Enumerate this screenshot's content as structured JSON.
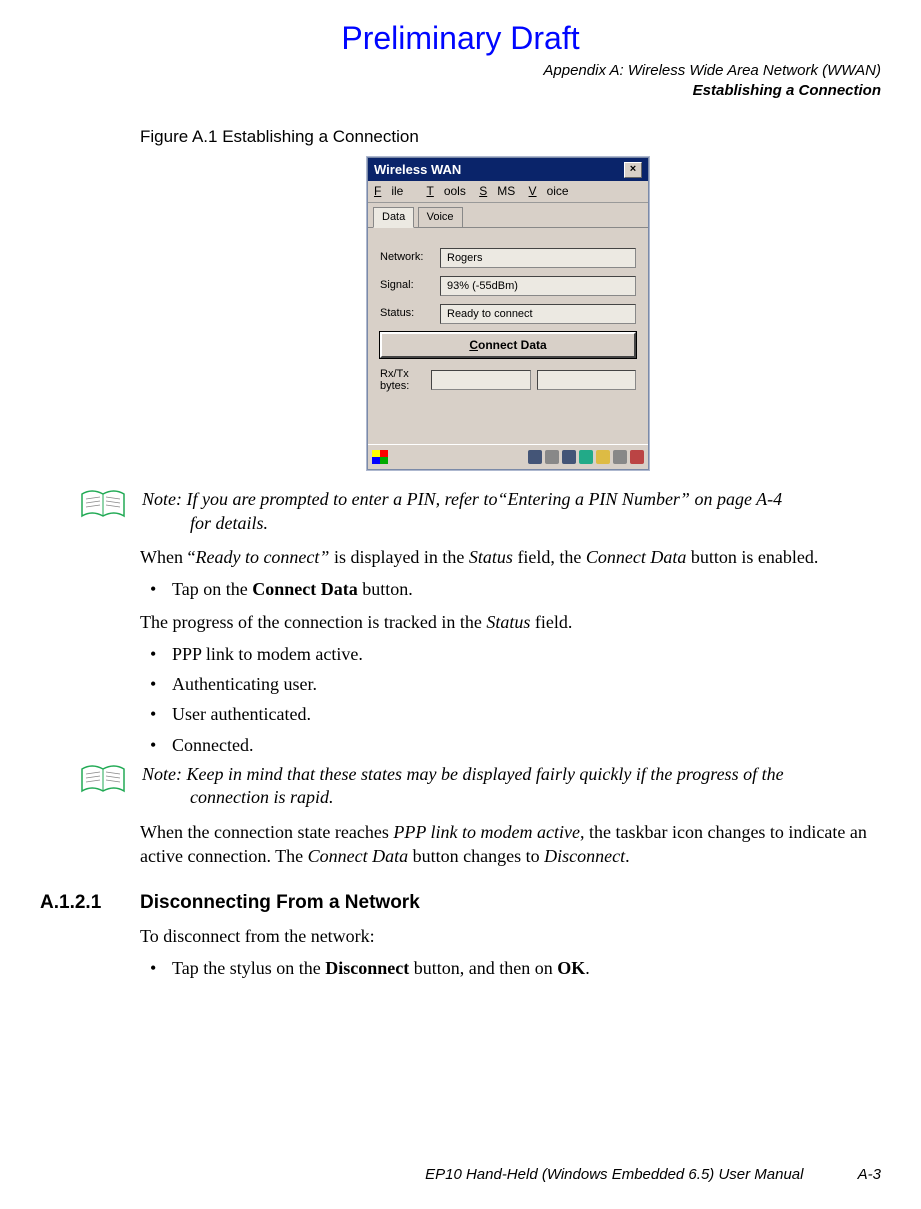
{
  "preliminary": "Preliminary Draft",
  "header": {
    "appendix": "Appendix A: Wireless Wide Area Network (WWAN)",
    "section": "Establishing a Connection"
  },
  "figure_caption": "Figure A.1  Establishing a Connection",
  "screenshot": {
    "title": "Wireless WAN",
    "menu": {
      "file": "File",
      "tools": "Tools",
      "sms": "SMS",
      "voice": "Voice"
    },
    "tabs": {
      "data": "Data",
      "voice": "Voice"
    },
    "labels": {
      "network": "Network:",
      "signal": "Signal:",
      "status": "Status:",
      "rxtx": "Rx/Tx bytes:"
    },
    "values": {
      "network": "Rogers",
      "signal": "93% (-55dBm)",
      "status": "Ready to connect"
    },
    "button": "Connect Data"
  },
  "note1": {
    "prefix": "Note:",
    "text_a": "If you are prompted to enter a PIN, refer to“Entering a PIN Number” on page A-4",
    "text_b": "for details."
  },
  "para1_a": "When “",
  "para1_b": "Ready to connect”",
  "para1_c": " is displayed in the ",
  "para1_d": "Status",
  "para1_e": " field, the ",
  "para1_f": "Connect Data",
  "para1_g": " button is enabled.",
  "bullet1_a": "Tap on the ",
  "bullet1_b": "Connect Data",
  "bullet1_c": " button.",
  "para2_a": "The progress of the connection is tracked in the ",
  "para2_b": "Status",
  "para2_c": " field.",
  "status_items": [
    "PPP link to modem active.",
    "Authenticating user.",
    "User authenticated.",
    "Connected."
  ],
  "note2": {
    "prefix": "Note:",
    "text_a": "Keep in mind that these states may be displayed fairly quickly if the progress of the",
    "text_b": "connection is rapid."
  },
  "para3_a": "When the connection state reaches ",
  "para3_b": "PPP link to modem active",
  "para3_c": ", the taskbar icon changes to indicate an active connection. The ",
  "para3_d": "Connect Data",
  "para3_e": " button changes to ",
  "para3_f": "Disconnect",
  "para3_g": ".",
  "subsection": {
    "num": "A.1.2.1",
    "title": "Disconnecting From a Network"
  },
  "para4": "To disconnect from the network:",
  "bullet2_a": "Tap the stylus on the ",
  "bullet2_b": "Disconnect",
  "bullet2_c": " button, and then on ",
  "bullet2_d": "OK",
  "bullet2_e": ".",
  "footer": {
    "doc": "EP10 Hand-Held (Windows Embedded 6.5) User Manual",
    "page": "A-3"
  }
}
